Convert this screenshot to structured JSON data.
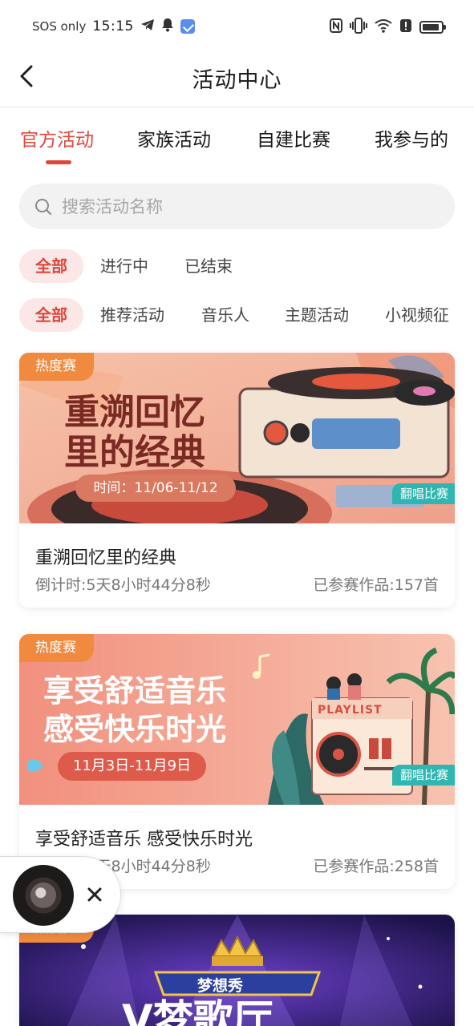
{
  "status_bar": {
    "carrier": "SOS only",
    "time": "15:15",
    "icons": [
      "telegram-icon",
      "bell-icon",
      "mail-icon",
      "nfc-icon",
      "vibrate-icon",
      "wifi-icon",
      "alert-icon",
      "battery-icon"
    ]
  },
  "header": {
    "title": "活动中心",
    "back_icon": "chevron-left-icon"
  },
  "tabs": [
    {
      "label": "官方活动",
      "active": true
    },
    {
      "label": "家族活动",
      "active": false
    },
    {
      "label": "自建比赛",
      "active": false
    },
    {
      "label": "我参与的",
      "active": false
    }
  ],
  "search": {
    "placeholder": "搜索活动名称"
  },
  "status_filters": [
    {
      "label": "全部",
      "active": true
    },
    {
      "label": "进行中",
      "active": false
    },
    {
      "label": "已结束",
      "active": false
    }
  ],
  "category_filters": [
    {
      "label": "全部",
      "active": true
    },
    {
      "label": "推荐活动",
      "active": false
    },
    {
      "label": "音乐人",
      "active": false
    },
    {
      "label": "主题活动",
      "active": false
    },
    {
      "label": "小视频征",
      "active": false
    }
  ],
  "colors": {
    "accent": "#e0463b",
    "accent_bg": "#fbe7e5",
    "hot_tag": "#f08a3e",
    "type_tag": "#2fb6b0"
  },
  "cards": [
    {
      "hot_tag": "热度赛",
      "type_tag": "翻唱比赛",
      "banner_title_line1": "重溯回忆",
      "banner_title_line2": "里的经典",
      "banner_date": "时间：11/06-11/12",
      "name": "重溯回忆里的经典",
      "countdown": "倒计时:5天8小时44分8秒",
      "entries": "已参赛作品:157首"
    },
    {
      "hot_tag": "热度赛",
      "type_tag": "翻唱比赛",
      "banner_title_line1": "享受舒适音乐",
      "banner_title_line2": "感受快乐时光",
      "banner_date": "11月3日-11月9日",
      "banner_sign": "PLAYLIST",
      "name": "享受舒适音乐 感受快乐时光",
      "countdown": "倒计时:2天8小时44分8秒",
      "entries": "已参赛作品:258首"
    },
    {
      "hot_tag": "热度赛",
      "banner_badge": "梦想秀",
      "banner_title_partial": "V梦歌厅"
    }
  ],
  "float_player": {
    "close_icon": "close-icon"
  }
}
